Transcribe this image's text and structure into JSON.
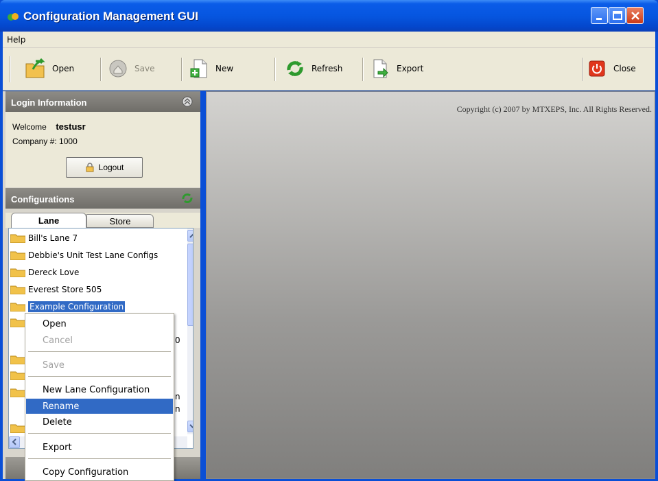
{
  "window": {
    "title": "Configuration Management GUI"
  },
  "menu": {
    "help": "Help"
  },
  "toolbar": {
    "open": "Open",
    "save": "Save",
    "new": "New",
    "refresh": "Refresh",
    "export": "Export",
    "close": "Close"
  },
  "login": {
    "header": "Login Information",
    "welcome_label": "Welcome",
    "username": "testusr",
    "company_label": "Company #:",
    "company_number": "1000",
    "logout": "Logout"
  },
  "configurations": {
    "header": "Configurations",
    "tabs": {
      "lane": "Lane",
      "store": "Store"
    },
    "items": [
      "Bill's Lane 7",
      "Debbie's Unit Test Lane Configs",
      "Dereck Love",
      "Everest Store 505",
      "Example Configuration"
    ],
    "partial_fragments": [
      "0",
      "n",
      "n"
    ]
  },
  "content": {
    "copyright": "Copyright (c) 2007 by MTXEPS, Inc. All Rights Reserved."
  },
  "context_menu": {
    "open": "Open",
    "cancel": "Cancel",
    "save": "Save",
    "new_lane": "New Lane Configuration",
    "rename": "Rename",
    "delete": "Delete",
    "export": "Export",
    "copy": "Copy Configuration"
  },
  "colors": {
    "title_blue": "#0656e0",
    "selection": "#316ac5",
    "chrome": "#ece9d8"
  }
}
